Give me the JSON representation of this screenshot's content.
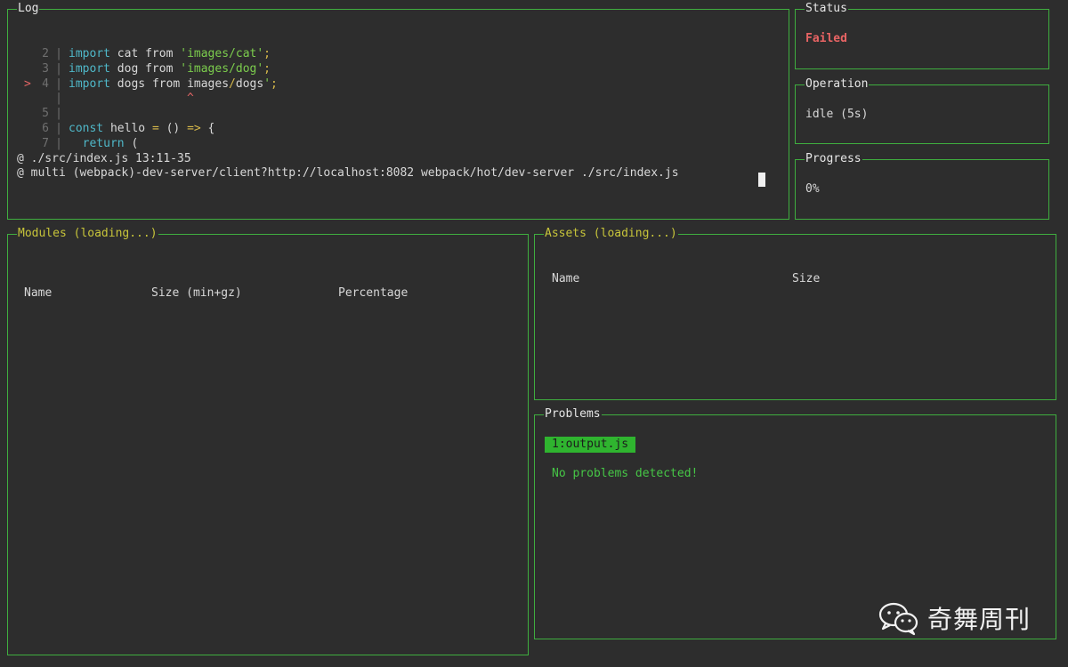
{
  "log": {
    "title": "Log",
    "code_lines": [
      {
        "marker": "",
        "num": "2",
        "parts": [
          [
            "kw",
            "import"
          ],
          [
            "id",
            " cat "
          ],
          [
            "id",
            "from"
          ],
          [
            "str",
            " 'images/cat'"
          ],
          [
            "op",
            ";"
          ]
        ]
      },
      {
        "marker": "",
        "num": "3",
        "parts": [
          [
            "kw",
            "import"
          ],
          [
            "id",
            " dog "
          ],
          [
            "id",
            "from"
          ],
          [
            "str",
            " 'images/dog'"
          ],
          [
            "op",
            ";"
          ]
        ]
      },
      {
        "marker": ">",
        "num": "4",
        "parts": [
          [
            "kw",
            "import"
          ],
          [
            "id",
            " dogs "
          ],
          [
            "id",
            "from"
          ],
          [
            "id",
            " images"
          ],
          [
            "op",
            "/"
          ],
          [
            "id",
            "dogs"
          ],
          [
            "str",
            "'"
          ],
          [
            "op",
            ";"
          ]
        ]
      },
      {
        "marker": "",
        "num": "",
        "parts": [
          [
            "caret",
            "                 ^"
          ]
        ]
      },
      {
        "marker": "",
        "num": "5",
        "parts": []
      },
      {
        "marker": "",
        "num": "6",
        "parts": [
          [
            "kw",
            "const"
          ],
          [
            "id",
            " hello "
          ],
          [
            "op",
            "="
          ],
          [
            "id",
            " () "
          ],
          [
            "op",
            "=>"
          ],
          [
            "id",
            " {"
          ]
        ]
      },
      {
        "marker": "",
        "num": "7",
        "parts": [
          [
            "id",
            "  "
          ],
          [
            "kw",
            "return"
          ],
          [
            "id",
            " ("
          ]
        ]
      }
    ],
    "stack": [
      "@ ./src/index.js 13:11-35",
      "@ multi (webpack)-dev-server/client?http://localhost:8082 webpack/hot/dev-server ./src/index.js"
    ]
  },
  "status": {
    "title": "Status",
    "value": "Failed",
    "color": "#e86464"
  },
  "operation": {
    "title": "Operation",
    "value": "idle (5s)"
  },
  "progress": {
    "title": "Progress",
    "value": "0%"
  },
  "modules": {
    "title": "Modules (loading...)",
    "columns": [
      "Name",
      "Size (min+gz)",
      "Percentage"
    ]
  },
  "assets": {
    "title": "Assets (loading...)",
    "columns": [
      "Name",
      "Size"
    ]
  },
  "problems": {
    "title": "Problems",
    "tab": "1:output.js",
    "message": "No problems detected!"
  },
  "watermark": {
    "text": "奇舞周刊",
    "icon": "wechat-icon"
  },
  "colors": {
    "border": "#3fae3f",
    "accent": "#2fb42f",
    "title_yellow": "#c7c43a"
  }
}
